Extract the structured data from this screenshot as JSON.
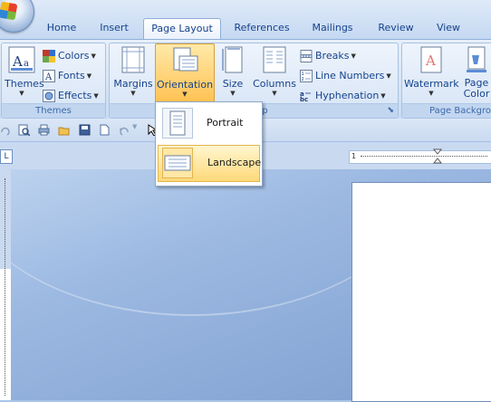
{
  "tabs": [
    {
      "label": "Home"
    },
    {
      "label": "Insert"
    },
    {
      "label": "Page Layout",
      "active": true
    },
    {
      "label": "References"
    },
    {
      "label": "Mailings"
    },
    {
      "label": "Review"
    },
    {
      "label": "View"
    }
  ],
  "ribbon": {
    "themes_group": {
      "label": "Themes",
      "themes_button": "Themes",
      "colors_button": "Colors",
      "fonts_button": "Fonts",
      "effects_button": "Effects"
    },
    "page_setup_group": {
      "label_fragment": "up",
      "margins_button": "Margins",
      "orientation_button": "Orientation",
      "size_button": "Size",
      "columns_button": "Columns",
      "breaks_button": "Breaks",
      "line_numbers_button": "Line Numbers",
      "hyphenation_button": "Hyphenation"
    },
    "page_background_group": {
      "label": "Page Backgro",
      "watermark_button": "Watermark",
      "page_color_line1": "Page",
      "page_color_line2": "Color"
    }
  },
  "orientation_menu": {
    "items": [
      {
        "label": "Portrait"
      },
      {
        "label": "Landscape",
        "highlighted": true
      }
    ]
  },
  "ruler": {
    "corner_symbol": "L",
    "start_number": "1"
  },
  "icons": [
    "office-button-icon",
    "themes-icon",
    "colors-icon",
    "fonts-icon",
    "effects-icon",
    "margins-icon",
    "orientation-icon",
    "size-icon",
    "columns-icon",
    "breaks-icon",
    "line-numbers-icon",
    "hyphenation-icon",
    "watermark-icon",
    "page-color-icon",
    "portrait-icon",
    "landscape-icon"
  ],
  "colors": {
    "accent_orange": "#ffc75a",
    "ribbon_text": "#15428b",
    "workspace": "#9cb9e2"
  }
}
